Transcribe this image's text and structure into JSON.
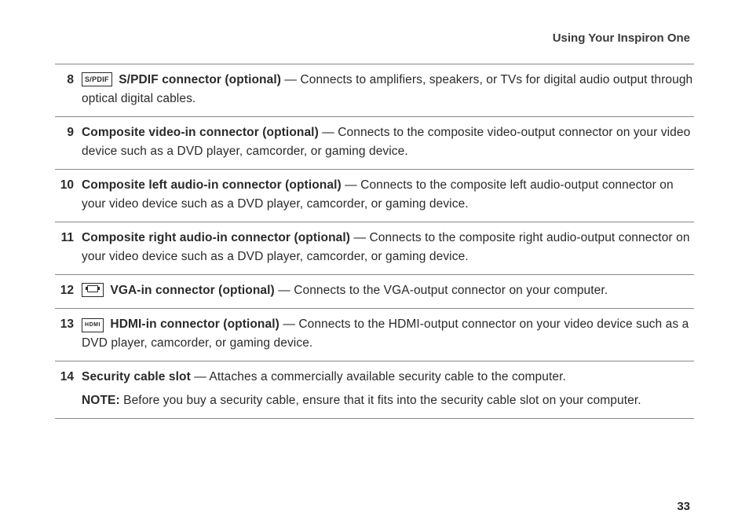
{
  "header": "Using Your Inspiron One",
  "page_number": "33",
  "items": {
    "i8": {
      "num": "8",
      "icon": "S/PDIF",
      "title": "S/PDIF connector (optional)",
      "desc_after": " — Connects to amplifiers, speakers, or TVs for digital audio output through optical digital cables."
    },
    "i9": {
      "num": "9",
      "title": "Composite video-in connector (optional)",
      "desc_after": " — Connects to the composite video-output connector on your video device such as a DVD player, camcorder, or gaming device."
    },
    "i10": {
      "num": "10",
      "title": "Composite left audio-in connector (optional)",
      "desc_after": " — Connects to the composite left audio-output connector on your video device such as a DVD player, camcorder, or gaming device."
    },
    "i11": {
      "num": "11",
      "title": "Composite right audio-in connector (optional)",
      "desc_after": " — Connects to the composite right audio-output connector on your video device such as a DVD player, camcorder, or gaming device."
    },
    "i12": {
      "num": "12",
      "title": "VGA-in connector (optional)",
      "desc_after": " — Connects to the VGA-output connector on your computer."
    },
    "i13": {
      "num": "13",
      "icon": "HDMI",
      "title": "HDMI-in connector (optional)",
      "desc_after": " — Connects to the HDMI-output connector on your video device such as a DVD player, camcorder, or gaming device."
    },
    "i14": {
      "num": "14",
      "title": "Security cable slot",
      "desc_after": " — Attaches a commercially available security cable to the computer.",
      "note_label": "NOTE:",
      "note_text": " Before you buy a security cable, ensure that it fits into the security cable slot on your computer."
    }
  }
}
